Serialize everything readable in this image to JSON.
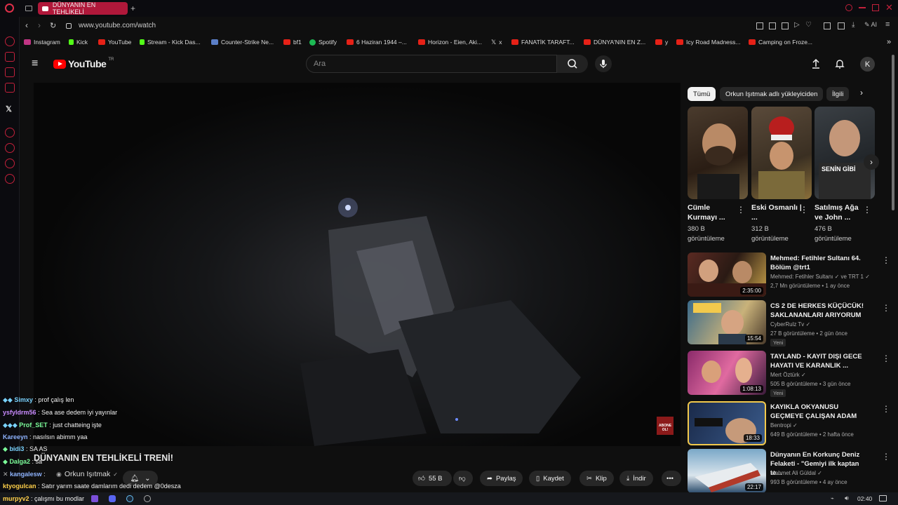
{
  "browser": {
    "tab_title": "DÜNYANIN EN TEHLİKELİ",
    "new_tab": "+",
    "url": "www.youtube.com/watch",
    "bookmarks": [
      "Instagram",
      "Kick",
      "YouTube",
      "Stream - Kick Das...",
      "Counter-Strike Ne...",
      "bf1",
      "Spotify",
      "6 Haziran 1944 –...",
      "Horizon - Eien, Aki...",
      "x",
      "FANATİK TARAFT...",
      "DÜNYA'NIN EN Z...",
      "y",
      "Icy Road Madness...",
      "Camping on Froze..."
    ],
    "ai_label": "AI"
  },
  "yt": {
    "logo": "YouTube",
    "region": "TR",
    "search_placeholder": "Ara",
    "avatar": "K"
  },
  "video": {
    "overlay_title": "DÜNYANIN EN TEHLİKELİ TRENİ!",
    "channel": "Orkun Işıtmak",
    "subscribe_badge": "ABONE OL!",
    "like_count": "55 B",
    "share": "Paylaş",
    "save": "Kaydet",
    "clip": "Klip",
    "download": "İndir"
  },
  "chat": [
    {
      "user": "Simxy",
      "msg": " : prof çalış len",
      "color": "#7ad3ff"
    },
    {
      "user": "ysfyldrm56",
      "msg": " : Sea ase dedem iyi yayınlar",
      "color": "#c98bff"
    },
    {
      "user": "Prof_SET",
      "msg": " : just chatteing işte",
      "color": "#7cfc9a"
    },
    {
      "user": "Kareeyn",
      "msg": " : nasılsın abimm yaa",
      "color": "#8fb4ff"
    },
    {
      "user": "bidi3",
      "msg": " : SA AS",
      "color": "#7ad3ff"
    },
    {
      "user": "Dalga2",
      "msg": " : sa",
      "color": "#7cfc9a"
    },
    {
      "user": "kangalesw",
      "msg": " :",
      "color": "#8fb4ff"
    },
    {
      "user": "ktyogulcan",
      "msg": " : Satır yarım saate damlarım dedi dedem @0desza",
      "color": "#ffd04a"
    },
    {
      "user": "murpyv2",
      "msg": " : çalışmı bu modlar",
      "color": "#ffd04a"
    }
  ],
  "filters": [
    "Tümü",
    "Orkun Işıtmak adlı yükleyiciden",
    "İlgili"
  ],
  "shorts": [
    {
      "title": "Cümle Kurmayı ...",
      "views": "380 B görüntüleme"
    },
    {
      "title": "Eski Osmanlı | ...",
      "views": "312 B görüntüleme"
    },
    {
      "title": "Satılmış Ağa ve John ...",
      "views": "476 B görüntüleme",
      "overlay": "SENİN GİBİ"
    }
  ],
  "recommended": [
    {
      "title": "Mehmed: Fetihler Sultanı 64. Bölüm @trt1",
      "channel": "Mehmed: Fetihler Sultanı ✓ ve TRT 1 ✓",
      "meta": "2,7 Mn görüntüleme • 1 ay önce",
      "duration": "2:35:00",
      "badge": ""
    },
    {
      "title": "CS 2 DE HERKES KÜÇÜCÜK! SAKLANANLARI ARIYORUM",
      "channel": "CyberRulz Tv ✓",
      "meta": "27 B görüntüleme • 2 gün önce",
      "duration": "15:54",
      "badge": "Yeni"
    },
    {
      "title": "TAYLAND - KAYIT DIŞI GECE HAYATI VE KARANLIK ...",
      "channel": "Mert Öztürk ✓",
      "meta": "505 B görüntüleme • 3 gün önce",
      "duration": "1:08:13",
      "badge": "Yeni"
    },
    {
      "title": "KAYIKLA OKYANUSU GEÇMEYE ÇALIŞAN ADAM",
      "channel": "Bentropi ✓",
      "meta": "649 B görüntüleme • 2 hafta önce",
      "duration": "18:33",
      "badge": ""
    },
    {
      "title": "Dünyanın En Korkunç Deniz Felaketi - \"Gemiyi ilk kaptan te...",
      "channel": "Mehmet Ali Güldal ✓",
      "meta": "993 B görüntüleme • 4 ay önce",
      "duration": "22:17",
      "badge": ""
    }
  ],
  "taskbar": {
    "time": "02:40"
  }
}
